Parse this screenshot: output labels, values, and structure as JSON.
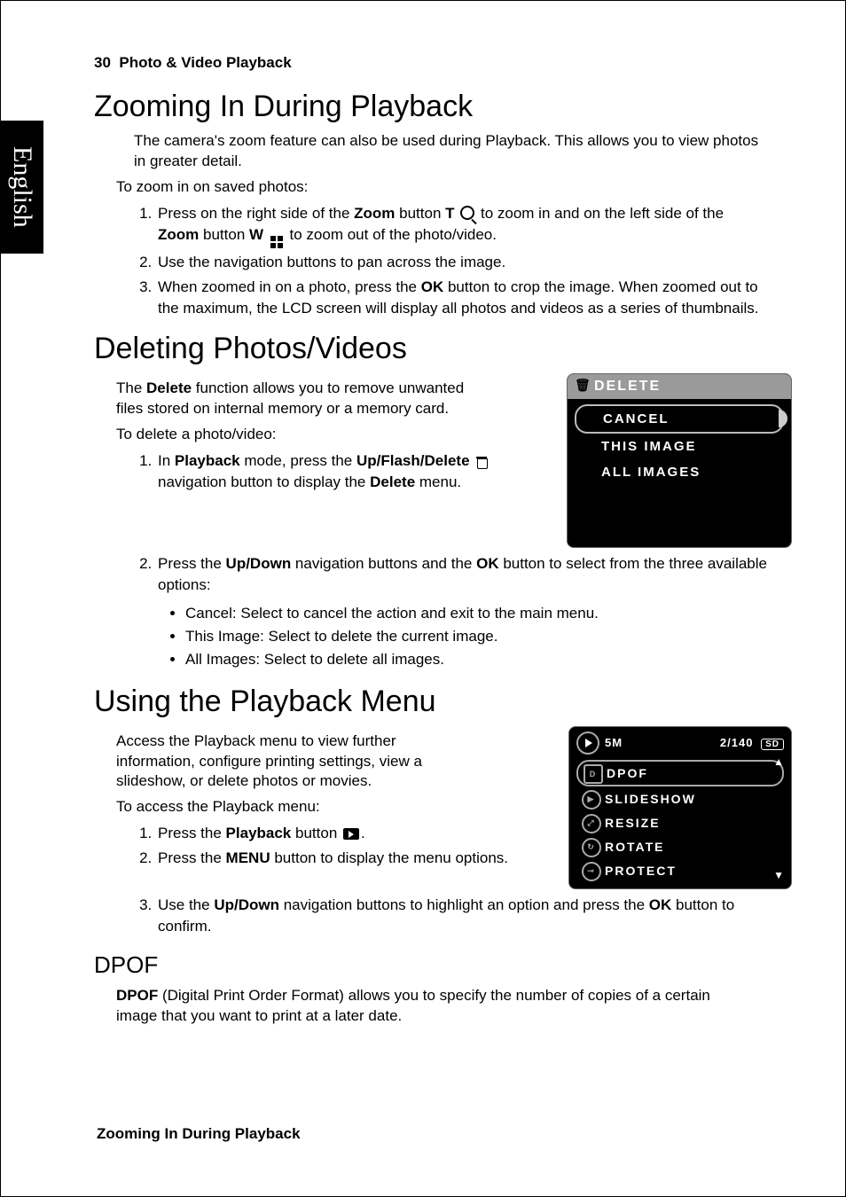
{
  "page_number": "30",
  "chapter": "Photo & Video Playback",
  "side_tab": "English",
  "running_foot": "Zooming In During Playback",
  "s1": {
    "title": "Zooming In During Playback",
    "intro": "The camera's zoom feature can also be used during Playback. This allows you to view photos in greater detail.",
    "lead": "To zoom in on saved photos:",
    "step1a": "Press on the right side of the ",
    "step1b": " button ",
    "step1c": " to zoom in and on the left side of the ",
    "step1d": " button ",
    "step1e": " to zoom out of the photo/video.",
    "zoom": "Zoom",
    "t": "T",
    "w": "W",
    "step2": "Use the navigation buttons to pan across the image.",
    "step3a": "When zoomed in on a photo, press the ",
    "step3b": " button to crop the image. When zoomed out to the maximum, the LCD screen will display all photos and videos as a series of thumbnails.",
    "ok": "OK"
  },
  "s2": {
    "title": "Deleting Photos/Videos",
    "intro_a": "The ",
    "intro_b": " function allows you to remove unwanted files stored on internal memory or a memory card.",
    "delete": "Delete",
    "lead": "To delete a photo/video:",
    "step1a": "In ",
    "step1b": " mode, press the ",
    "step1c": " navigation button to display the ",
    "step1d": " menu.",
    "playback": "Playback",
    "ufd": "Up/Flash/Delete",
    "step2a": "Press the ",
    "step2b": " navigation buttons and the ",
    "step2c": " button to select from the three available options:",
    "updown": "Up/Down",
    "ok": "OK",
    "opt1": "Cancel: Select to cancel the action and exit to the main menu.",
    "opt2": "This Image: Select to delete the current image.",
    "opt3": "All Images: Select to delete all images."
  },
  "delete_lcd": {
    "title": "DELETE",
    "items": [
      "CANCEL",
      "THIS IMAGE",
      "ALL IMAGES"
    ]
  },
  "s3": {
    "title": "Using the Playback Menu",
    "intro": "Access the Playback menu to view further information, configure printing settings, view a slideshow, or delete photos or movies.",
    "lead": "To access the Playback menu:",
    "step1a": "Press the ",
    "step1b": " button ",
    "step1c": ".",
    "playback": "Playback",
    "step2a": "Press the ",
    "step2b": " button to display the menu options.",
    "menu": "MENU",
    "step3a": "Use the ",
    "step3b": " navigation buttons to highlight an option and press the ",
    "step3c": " button to confirm.",
    "updown": "Up/Down",
    "ok": "OK"
  },
  "pb_lcd": {
    "res": "5M",
    "counter": "2/140",
    "sd": "SD",
    "items": [
      "DPOF",
      "SLIDESHOW",
      "RESIZE",
      "ROTATE",
      "PROTECT"
    ]
  },
  "s4": {
    "title": "DPOF",
    "body_a": "DPOF",
    "body_b": " (Digital Print Order Format) allows you to specify the number of copies of a certain image that you want to print at a later date."
  }
}
